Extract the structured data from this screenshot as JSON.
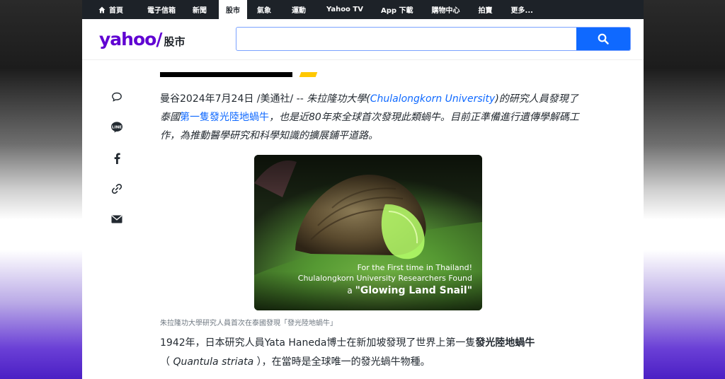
{
  "nav": {
    "items": [
      "首頁",
      "電子信箱",
      "新聞",
      "股市",
      "氣象",
      "運動",
      "Yahoo TV",
      "App 下載",
      "購物中心",
      "拍賣",
      "更多..."
    ],
    "active_index": 3
  },
  "header": {
    "logo": "yahoo/",
    "section": "股市",
    "search_value": ""
  },
  "share": {
    "icons": [
      "comment-icon",
      "line-icon",
      "facebook-icon",
      "link-icon",
      "mail-icon"
    ]
  },
  "article": {
    "p1_start": "曼谷2024年7月24日 /美通社/ -- ",
    "p1_it1": "朱拉隆功大學(",
    "p1_link1": "Chulalongkorn University",
    "p1_it2": ")的研究人員發現了泰國",
    "p1_link2": "第一隻發光陸地蝸牛",
    "p1_it3": "，也是近80年來全球首次發現此類蝸牛。目前正準備進行遺傳學解碼工作，為推動醫學研究和科學知識的擴展鋪平道路。",
    "image": {
      "line1": "For the First time in Thailand!",
      "line2": "Chulalongkorn University Researchers Found",
      "line3_prefix": "a ",
      "line3_main": "\"Glowing Land Snail\""
    },
    "caption": "朱拉隆功大學研究人員首次在泰國發現「發光陸地蝸牛」",
    "p2_start": "1942年，日本研究人員Yata Haneda博士在新加坡發現了世界上第一隻",
    "p2_bold": "發光陸地蝸牛",
    "p2_paren_open": "（ ",
    "p2_species": "Quantula striata",
    "p2_end": " ），在當時是全球唯一的發光蝸牛物種。"
  }
}
